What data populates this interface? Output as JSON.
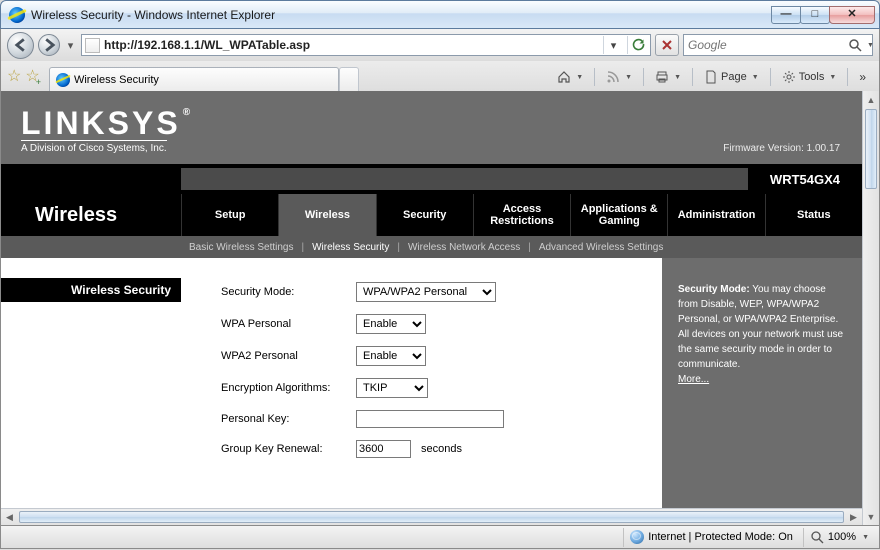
{
  "window": {
    "title": "Wireless Security - Windows Internet Explorer"
  },
  "address": {
    "url": "http://192.168.1.1/WL_WPATable.asp"
  },
  "search": {
    "placeholder": "Google"
  },
  "tab": {
    "title": "Wireless Security"
  },
  "cmdbar": {
    "page": "Page",
    "tools": "Tools"
  },
  "linksys": {
    "brand": "LINKSYS",
    "tagline": "A Division of Cisco Systems, Inc.",
    "firmware_label": "Firmware Version: 1.00.17",
    "model": "WRT54GX4",
    "section": "Wireless",
    "tabs": [
      "Setup",
      "Wireless",
      "Security",
      "Access Restrictions",
      "Applications & Gaming",
      "Administration",
      "Status"
    ],
    "subtabs": [
      "Basic Wireless Settings",
      "Wireless Security",
      "Wireless Network Access",
      "Advanced Wireless Settings"
    ],
    "side_label": "Wireless Security",
    "form": {
      "security_mode": {
        "label": "Security Mode:",
        "value": "WPA/WPA2 Personal"
      },
      "wpa_personal": {
        "label": "WPA Personal",
        "value": "Enable"
      },
      "wpa2_personal": {
        "label": "WPA2 Personal",
        "value": "Enable"
      },
      "encryption": {
        "label": "Encryption Algorithms:",
        "value": "TKIP"
      },
      "personal_key": {
        "label": "Personal Key:",
        "value": ""
      },
      "renewal": {
        "label": "Group Key Renewal:",
        "value": "3600",
        "unit": "seconds"
      }
    },
    "help": {
      "title": "Security Mode:",
      "body": "You may choose from Disable, WEP, WPA/WPA2 Personal, or WPA/WPA2 Enterprise. All devices on your network must use the same security mode in order to communicate.",
      "more": "More..."
    }
  },
  "status": {
    "zone": "Internet | Protected Mode: On",
    "zoom": "100%"
  }
}
